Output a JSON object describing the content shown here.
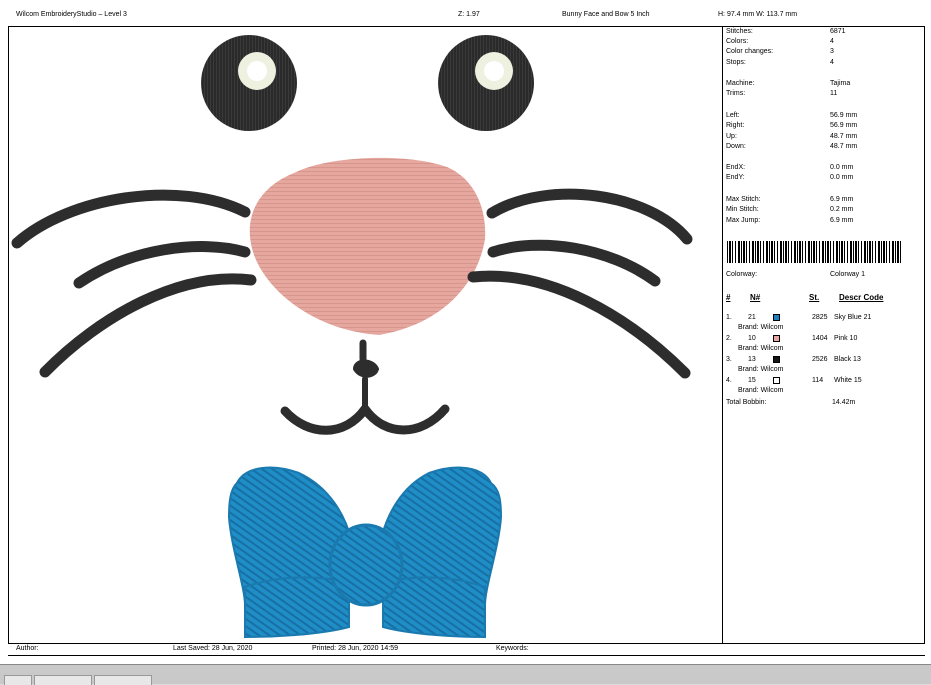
{
  "header": {
    "app_title": "Wilcom EmbroideryStudio – Level 3",
    "zoom": "Z: 1.97",
    "design_name": "Bunny Face and Bow 5 Inch",
    "size": "H: 97.4 mm   W: 113.7 mm"
  },
  "stats": [
    {
      "key": "Stitches:",
      "value": "6871"
    },
    {
      "key": "Colors:",
      "value": "4"
    },
    {
      "key": "Color changes:",
      "value": "3"
    },
    {
      "key": "Stops:",
      "value": "4"
    },
    {
      "key": "Machine:",
      "value": "Tajima"
    },
    {
      "key": "Trims:",
      "value": "11"
    },
    {
      "key": "Left:",
      "value": "56.9 mm"
    },
    {
      "key": "Right:",
      "value": "56.9 mm"
    },
    {
      "key": "Up:",
      "value": "48.7 mm"
    },
    {
      "key": "Down:",
      "value": "48.7 mm"
    },
    {
      "key": "EndX:",
      "value": "0.0 mm"
    },
    {
      "key": "EndY:",
      "value": "0.0 mm"
    },
    {
      "key": "Max Stitch:",
      "value": "6.9 mm"
    },
    {
      "key": "Min Stitch:",
      "value": "0.2 mm"
    },
    {
      "key": "Max Jump:",
      "value": "6.9 mm"
    }
  ],
  "colorway": {
    "label": "Colorway:",
    "value": "Colorway 1"
  },
  "thread_table": {
    "headers": {
      "num": "#",
      "n_num": "N#",
      "st": "St.",
      "descr_code": "Descr  Code"
    },
    "rows": [
      {
        "num": "1.",
        "n": "21",
        "color": "#1f7fc0",
        "st": "2825",
        "descr": "Sky Blue 21",
        "brand": "Brand: Wilcom"
      },
      {
        "num": "2.",
        "n": "10",
        "color": "#e8a7a0",
        "st": "1404",
        "descr": "Pink 10",
        "brand": "Brand: Wilcom"
      },
      {
        "num": "3.",
        "n": "13",
        "color": "#151515",
        "st": "2526",
        "descr": "Black 13",
        "brand": "Brand: Wilcom"
      },
      {
        "num": "4.",
        "n": "15",
        "color": "#ffffff",
        "st": "114",
        "descr": "White 15",
        "brand": "Brand: Wilcom"
      }
    ],
    "total_bobbin_label": "Total Bobbin:",
    "total_bobbin_value": "14.42m"
  },
  "footer": {
    "author": "Author:",
    "last_saved": "Last Saved: 28 Jun, 2020",
    "printed": "Printed: 28 Jun, 2020 14:59",
    "keywords": "Keywords:"
  }
}
